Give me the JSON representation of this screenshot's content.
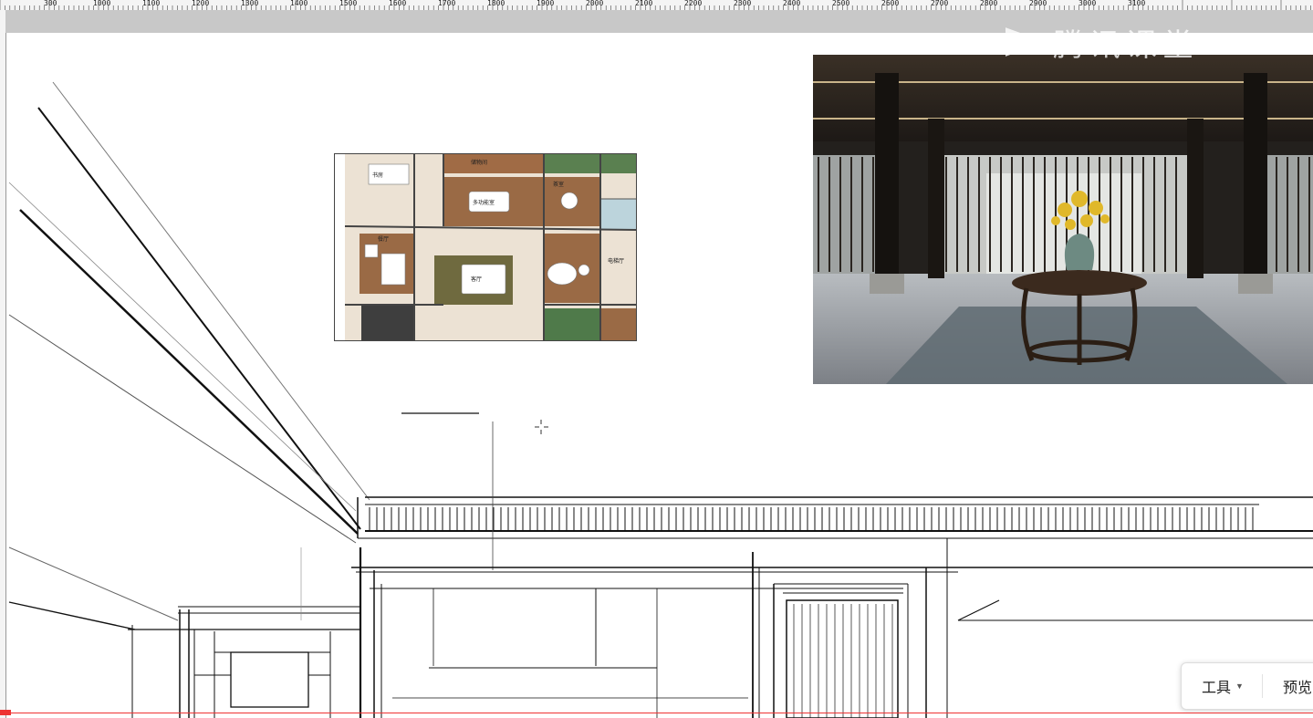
{
  "ruler": {
    "labels": [
      "300",
      "1000",
      "1100",
      "1200",
      "1300",
      "1400",
      "1500",
      "1600",
      "1700",
      "1800",
      "1900",
      "2000",
      "2100",
      "2200",
      "2300",
      "2400",
      "2500",
      "2600",
      "2700",
      "2800",
      "2900",
      "3000",
      "3100"
    ]
  },
  "watermark": {
    "text": "腾讯课堂",
    "icon": "play-triangle-icon"
  },
  "plan": {
    "rooms": [
      "书房",
      "多功能室",
      "茶室",
      "餐厅",
      "客厅",
      "储物间",
      "电梯厅"
    ],
    "colors": {
      "wood": "#9a6a45",
      "floor": "#ece2d4",
      "green": "#4f7a4a"
    }
  },
  "photo": {
    "colors": {
      "dark": "#23201d",
      "floor": "#8e9296",
      "flower": "#e0b82a",
      "rug": "#5f6b72"
    }
  },
  "toolbar": {
    "tools_label": "工具",
    "preview_label": "预览",
    "caret_icon": "caret-down-icon"
  },
  "colors": {
    "ruler_bg": "#f4f4f4",
    "topbar": "#c8c8c8",
    "red_guide": "#e33333"
  }
}
